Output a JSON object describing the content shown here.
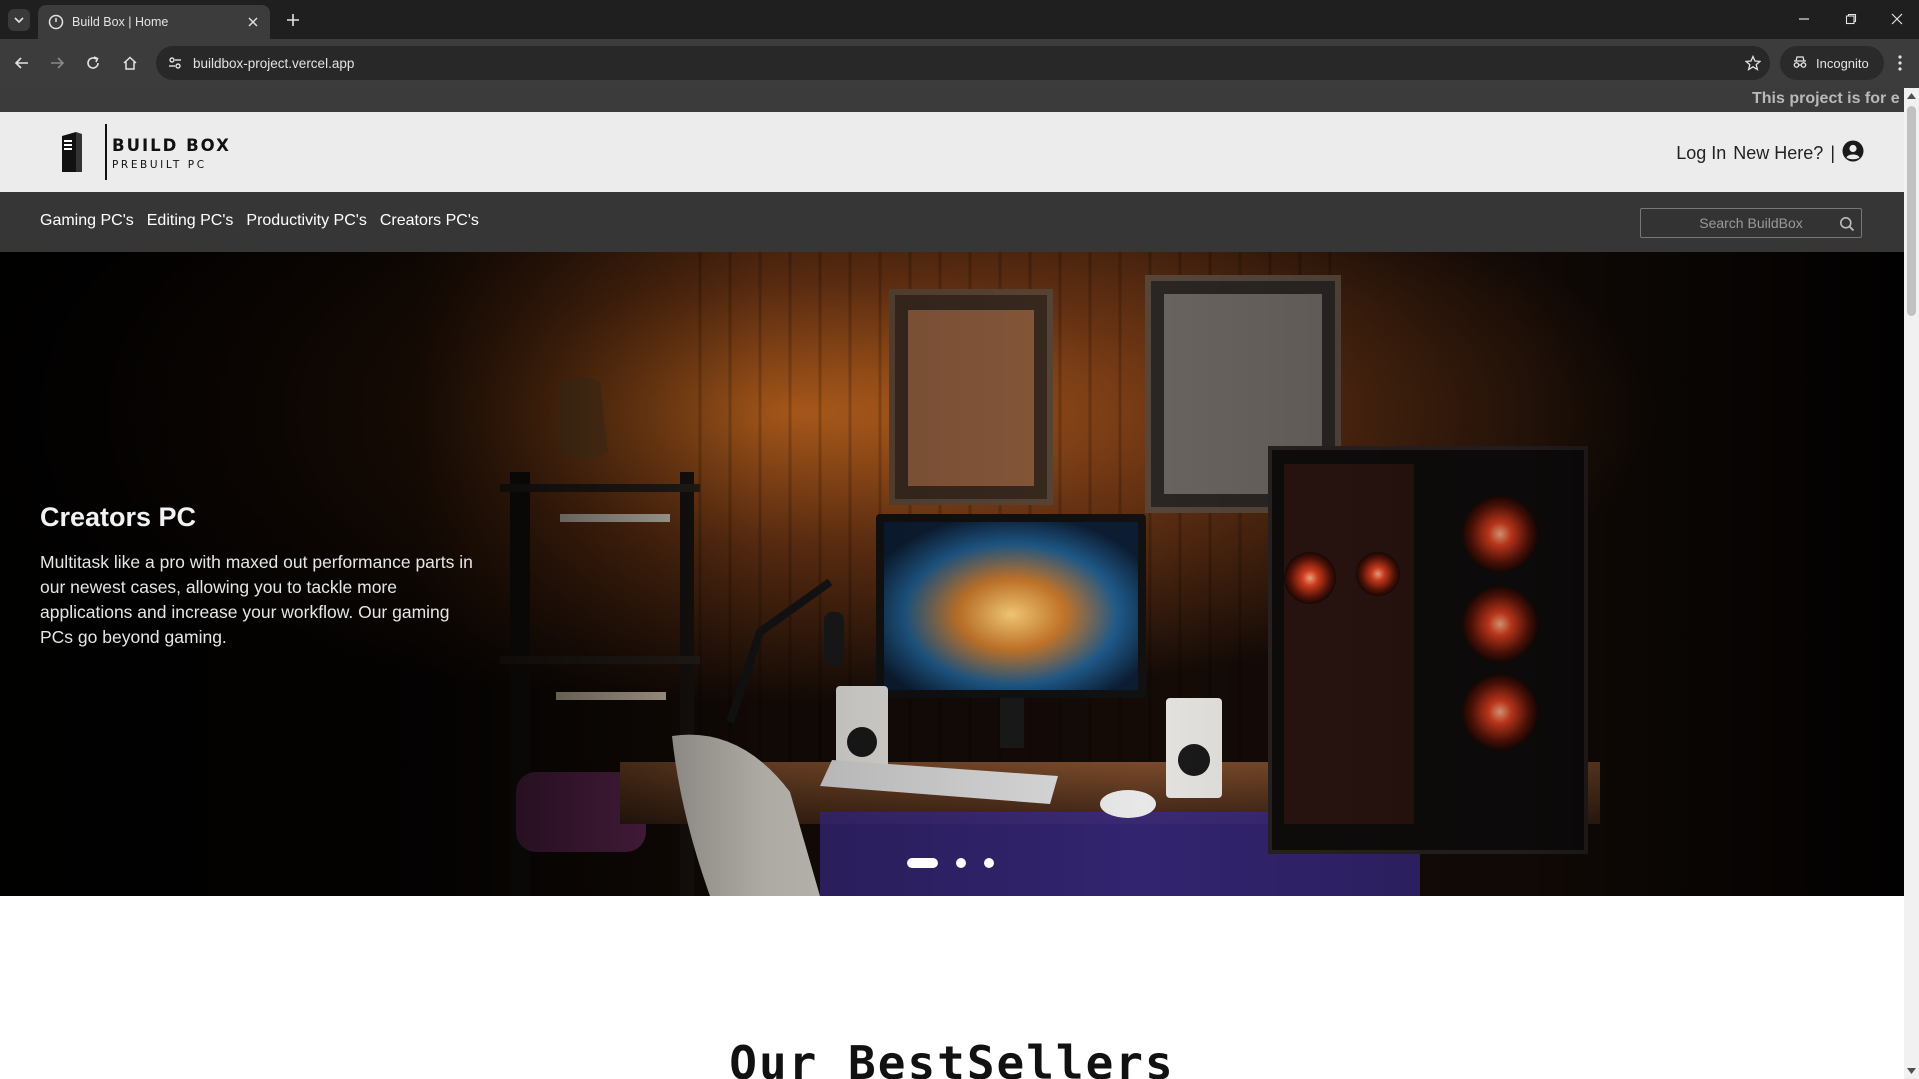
{
  "browser": {
    "tab_title": "Build Box | Home",
    "url": "buildbox-project.vercel.app",
    "profile_label": "Incognito"
  },
  "site": {
    "marquee_text": "This project is for e",
    "logo": {
      "word": "BUILD BOX",
      "sub": "PREBUILT PC"
    },
    "auth": {
      "login": "Log In",
      "signup": "New Here?",
      "separator": "|"
    },
    "nav": [
      {
        "label": "Gaming PC's"
      },
      {
        "label": "Editing PC's"
      },
      {
        "label": "Productivity PC's"
      },
      {
        "label": "Creators PC's"
      }
    ],
    "search_placeholder": "Search BuildBox",
    "hero": {
      "title": "Creators PC",
      "text": "Multitask like a pro with maxed out performance parts in our newest cases, allowing you to tackle more applications and increase your workflow. Our gaming PCs go beyond gaming.",
      "slide_count": 3,
      "active_slide": 1
    },
    "section_title": "Our BestSellers"
  },
  "colors": {
    "chrome_dark": "#1f1f1f",
    "chrome_toolbar": "#3c3c3c",
    "site_header": "#ececec",
    "site_nav": "#363636",
    "marquee_bar": "#3b3b3b"
  },
  "icons": [
    "tab-list-icon",
    "favicon-icon",
    "close-icon",
    "plus-icon",
    "minimize-icon",
    "restore-icon",
    "back-icon",
    "forward-icon",
    "reload-icon",
    "home-icon",
    "site-info-icon",
    "star-icon",
    "incognito-icon",
    "menu-icon",
    "user-icon",
    "search-icon"
  ]
}
